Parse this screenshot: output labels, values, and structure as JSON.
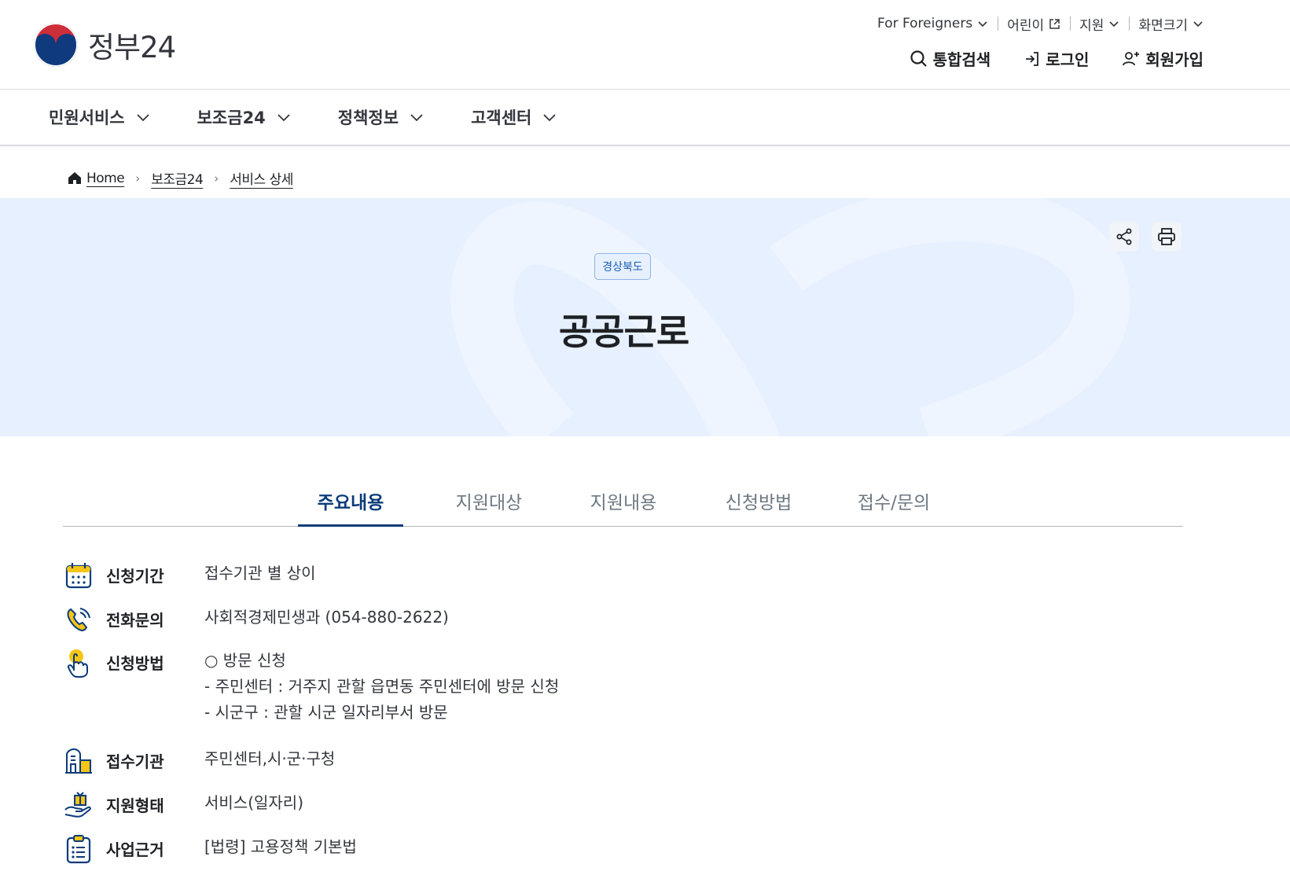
{
  "header": {
    "logo_text": "정부24",
    "util": [
      {
        "label": "For Foreigners",
        "icon": "chevron-down-icon"
      },
      {
        "label": "어린이",
        "icon": "external-link-icon"
      },
      {
        "label": "지원",
        "icon": "chevron-down-icon"
      },
      {
        "label": "화면크기",
        "icon": "chevron-down-icon"
      }
    ],
    "actions": {
      "search": "통합검색",
      "login": "로그인",
      "signup": "회원가입"
    }
  },
  "gnb": [
    {
      "label": "민원서비스"
    },
    {
      "label": "보조금24"
    },
    {
      "label": "정책정보"
    },
    {
      "label": "고객센터"
    }
  ],
  "breadcrumb": [
    "Home",
    "보조금24",
    "서비스 상세"
  ],
  "hero": {
    "region": "경상북도",
    "title": "공공근로"
  },
  "tabs": [
    "주요내용",
    "지원대상",
    "지원내용",
    "신청방법",
    "접수/문의"
  ],
  "info": [
    {
      "label": "신청기간",
      "value": "접수기관 별 상이",
      "icon": "calendar-icon"
    },
    {
      "label": "전화문의",
      "value": "사회적경제민생과 (054-880-2622)",
      "icon": "phone-icon"
    },
    {
      "label": "신청방법",
      "value": "○ 방문 신청\n- 주민센터 : 거주지 관할 읍면동 주민센터에 방문 신청\n- 시군구 : 관할 시군 일자리부서 방문",
      "icon": "hand-pointer-icon"
    },
    {
      "label": "접수기관",
      "value": "주민센터,시·군·구청",
      "icon": "building-icon"
    },
    {
      "label": "지원형태",
      "value": "서비스(일자리)",
      "icon": "gift-hand-icon"
    },
    {
      "label": "사업근거",
      "value": "[법령] 고용정책 기본법",
      "icon": "clipboard-list-icon"
    }
  ],
  "colors": {
    "hero_bg": "#e6f0ff",
    "active_tab": "#0b3b7a",
    "logo_red": "#cd2e3a",
    "logo_blue": "#0f3a7d",
    "icon_yellow": "#f5c518"
  }
}
